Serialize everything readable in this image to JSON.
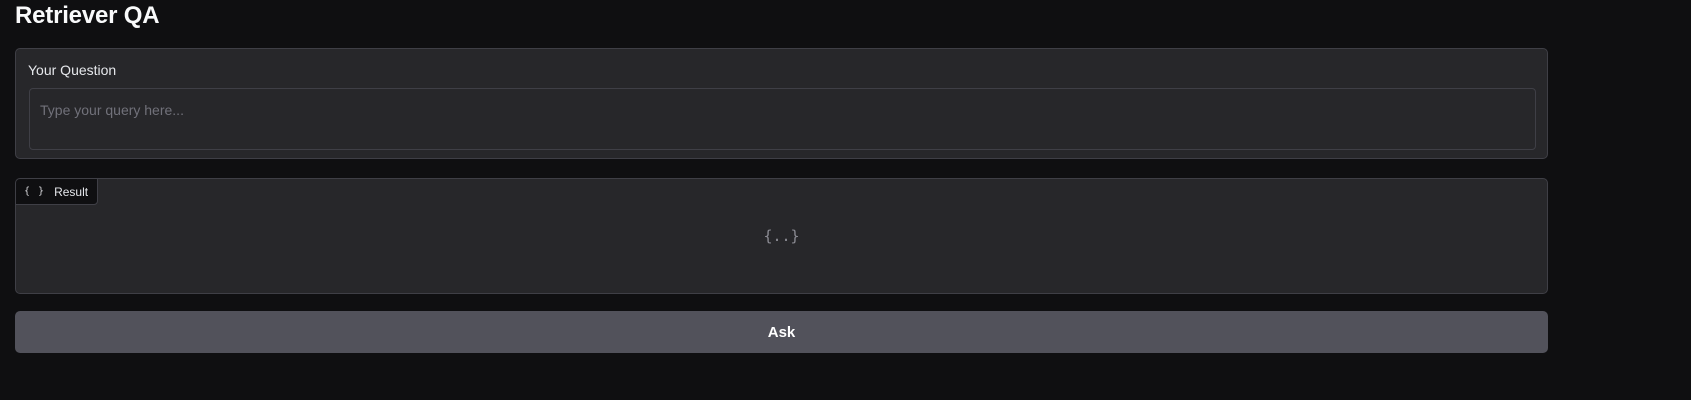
{
  "app": {
    "title": "Retriever QA"
  },
  "question": {
    "label": "Your Question",
    "placeholder": "Type your query here...",
    "value": ""
  },
  "result": {
    "label": "Result",
    "icon": "braces-icon",
    "icon_glyph": "{ }",
    "empty_placeholder": "{..}"
  },
  "actions": {
    "ask_label": "Ask"
  },
  "colors": {
    "background": "#0f0f11",
    "panel": "#27272a",
    "border": "#3f3f46",
    "button": "#52525b"
  }
}
